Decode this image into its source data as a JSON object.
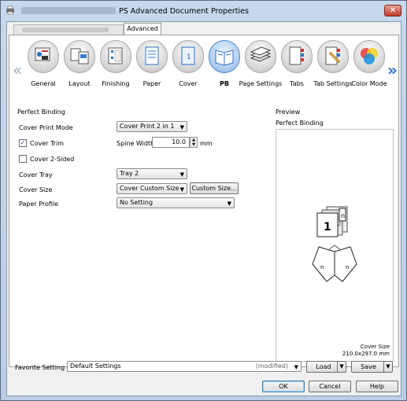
{
  "window": {
    "title": "PS Advanced Document Properties",
    "close_glyph": "✕"
  },
  "tabs": {
    "advanced_label": "Advanced"
  },
  "nav": {
    "left_arrow": "«",
    "right_arrow": "»",
    "categories": [
      {
        "label": "General",
        "icon": "general-icon"
      },
      {
        "label": "Layout",
        "icon": "layout-icon"
      },
      {
        "label": "Finishing",
        "icon": "finishing-icon"
      },
      {
        "label": "Paper",
        "icon": "paper-icon"
      },
      {
        "label": "Cover",
        "icon": "cover-icon"
      },
      {
        "label": "PB",
        "icon": "perfect-binding-icon",
        "selected": true
      },
      {
        "label": "Page Settings",
        "icon": "page-settings-icon"
      },
      {
        "label": "Tabs",
        "icon": "tabs-icon"
      },
      {
        "label": "Tab Settings",
        "icon": "tab-settings-icon"
      },
      {
        "label": "Color Mode",
        "icon": "color-mode-icon"
      }
    ]
  },
  "perfect_binding": {
    "group_title": "Perfect Binding",
    "cover_print_mode_label": "Cover Print Mode",
    "cover_print_mode_value": "Cover Print 2 in 1",
    "cover_trim_label": "Cover Trim",
    "cover_trim_checked": true,
    "spine_width_label": "Spine Width",
    "spine_width_value": "10.0",
    "spine_width_unit": "mm",
    "cover_2_sided_label": "Cover 2-Sided",
    "cover_2_sided_checked": false,
    "cover_tray_label": "Cover Tray",
    "cover_tray_value": "Tray 2",
    "cover_size_label": "Cover Size",
    "cover_size_value": "Cover Custom Size",
    "custom_size_button": "Custom Size...",
    "paper_profile_label": "Paper Profile",
    "paper_profile_value": "No Setting"
  },
  "preview": {
    "group_title": "Preview",
    "caption": "Perfect Binding",
    "cover_size_label": "Cover Size",
    "cover_size_value": "210.0x297.0 mm"
  },
  "favorite": {
    "label": "Favorite Setting",
    "value": "Default Settings",
    "status": "(modified)",
    "load_label": "Load",
    "save_label": "Save"
  },
  "footer": {
    "ok_label": "OK",
    "cancel_label": "Cancel",
    "help_label": "Help"
  }
}
